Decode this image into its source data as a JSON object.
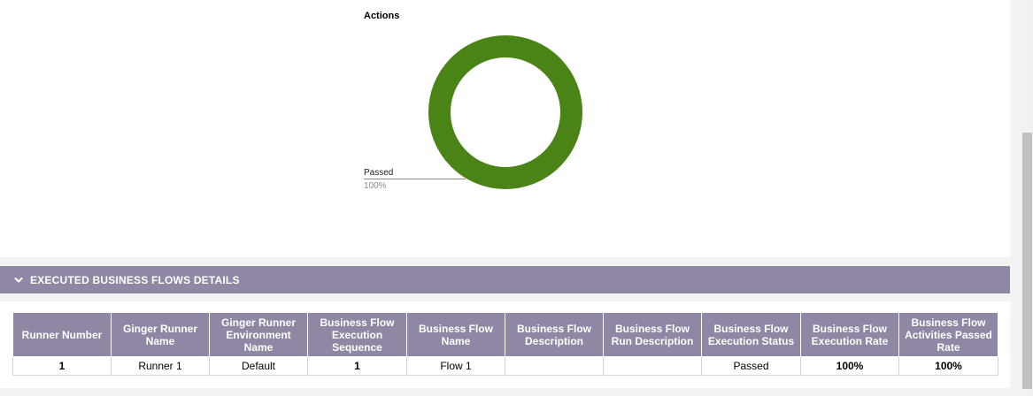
{
  "chart": {
    "title": "Actions"
  },
  "chart_data": {
    "type": "pie",
    "title": "Actions",
    "categories": [
      "Passed"
    ],
    "values": [
      100
    ],
    "slice_labels": [
      {
        "name": "Passed",
        "percent": "100%"
      }
    ],
    "colors": [
      "#4a8417"
    ],
    "donut": true
  },
  "section": {
    "title": "EXECUTED BUSINESS FLOWS DETAILS",
    "icon": "chevron-down-icon"
  },
  "table": {
    "headers": [
      "Runner Number",
      "Ginger Runner Name",
      "Ginger Runner Environment Name",
      "Business Flow Execution Sequence",
      "Business Flow Name",
      "Business Flow Description",
      "Business Flow Run Description",
      "Business Flow Execution Status",
      "Business Flow Execution Rate",
      "Business Flow Activities Passed Rate"
    ],
    "rows": [
      [
        "1",
        "Runner 1",
        "Default",
        "1",
        "Flow 1",
        "",
        "",
        "Passed",
        "100%",
        "100%"
      ]
    ]
  },
  "colors": {
    "header_bg": "#8f87a3",
    "passed_green": "#4a8417",
    "link_blue": "#1a73e8"
  }
}
